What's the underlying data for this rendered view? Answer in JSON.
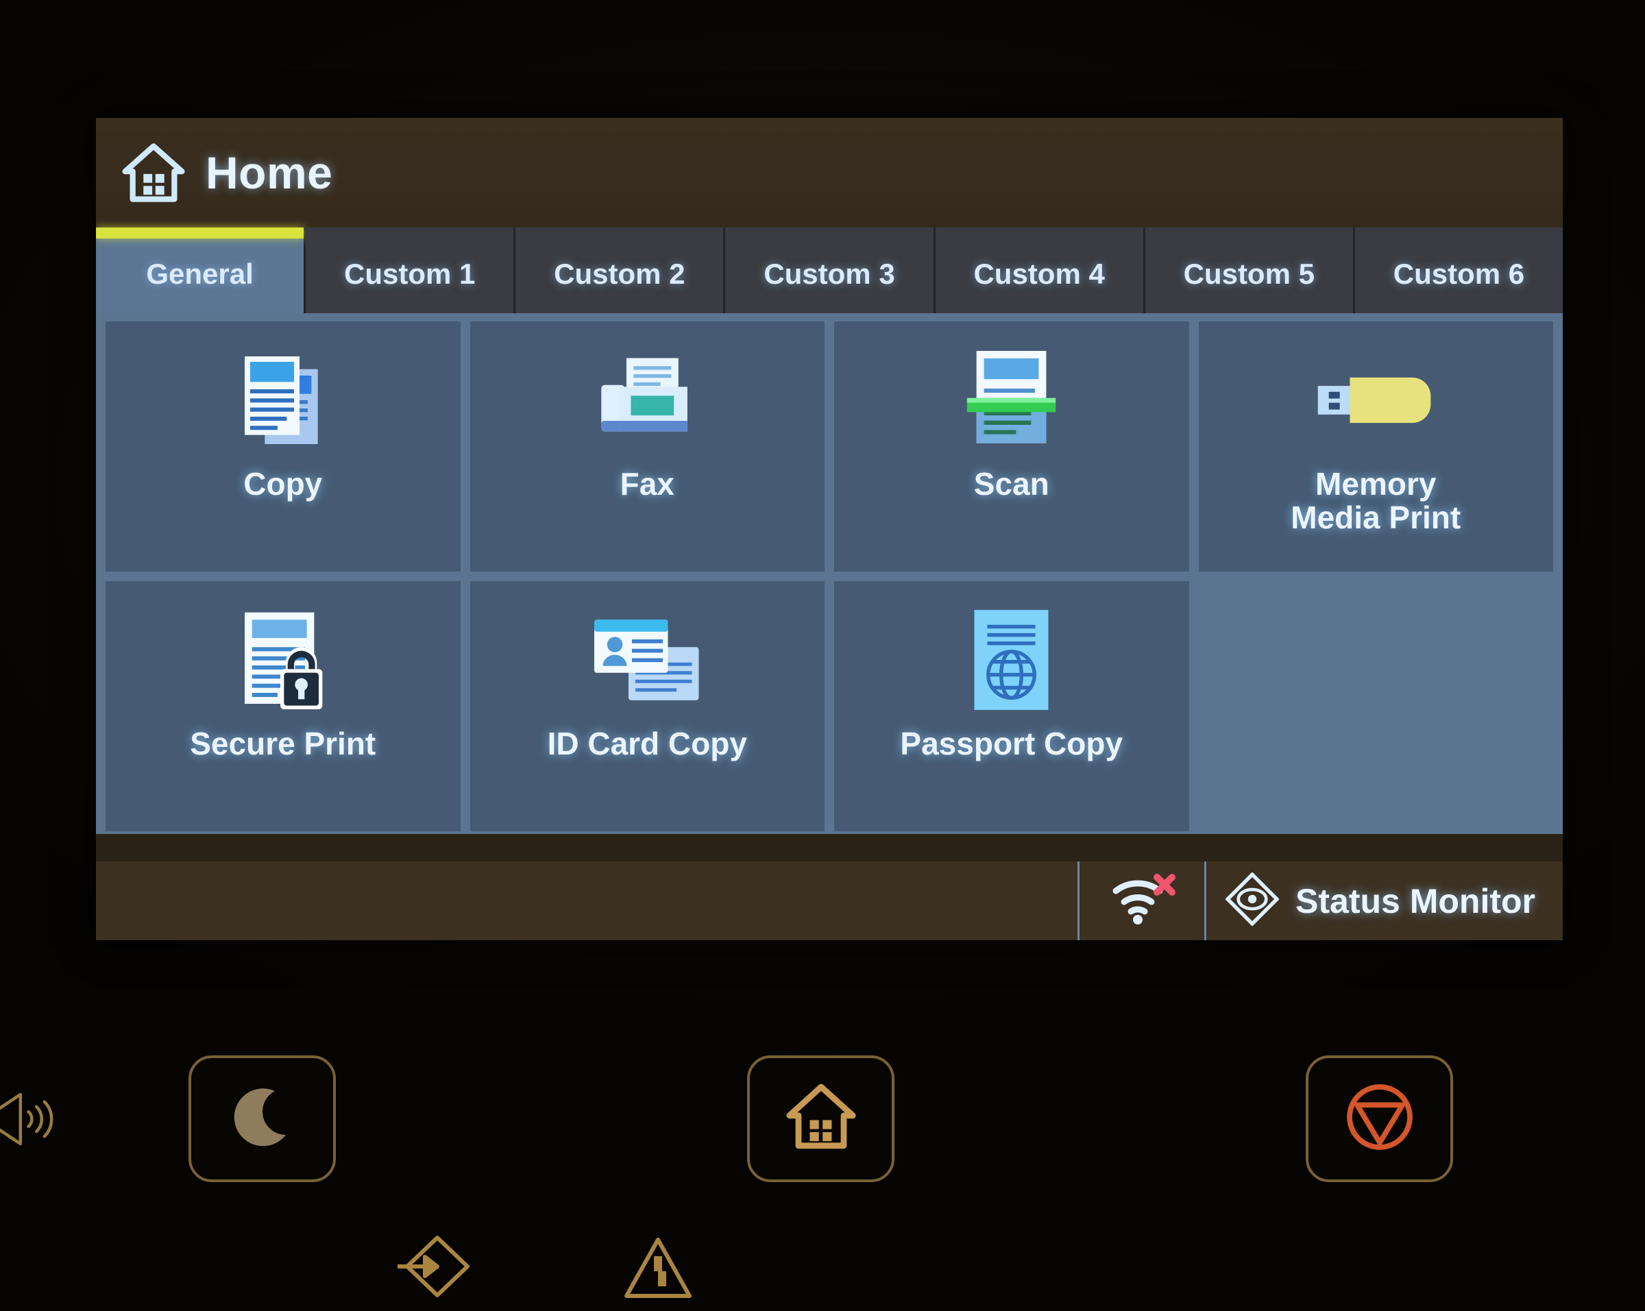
{
  "screen": {
    "header": {
      "title": "Home",
      "icon": "home-icon"
    },
    "tabs": [
      {
        "label": "General",
        "active": true,
        "name": "tab-general"
      },
      {
        "label": "Custom 1",
        "active": false,
        "name": "tab-custom-1"
      },
      {
        "label": "Custom 2",
        "active": false,
        "name": "tab-custom-2"
      },
      {
        "label": "Custom 3",
        "active": false,
        "name": "tab-custom-3"
      },
      {
        "label": "Custom 4",
        "active": false,
        "name": "tab-custom-4"
      },
      {
        "label": "Custom 5",
        "active": false,
        "name": "tab-custom-5"
      },
      {
        "label": "Custom 6",
        "active": false,
        "name": "tab-custom-6"
      }
    ],
    "tiles": [
      {
        "label": "Copy",
        "icon": "copy-documents-icon"
      },
      {
        "label": "Fax",
        "icon": "fax-machine-icon"
      },
      {
        "label": "Scan",
        "icon": "scan-document-icon"
      },
      {
        "label": "Memory\nMedia Print",
        "label_line1": "Memory",
        "label_line2": "Media Print",
        "icon": "usb-flash-drive-icon"
      },
      {
        "label": "Secure Print",
        "icon": "document-lock-icon"
      },
      {
        "label": "ID Card Copy",
        "icon": "id-cards-icon"
      },
      {
        "label": "Passport Copy",
        "icon": "passport-globe-icon"
      }
    ],
    "statusbar": {
      "wifi_icon": "wifi-disconnected-icon",
      "monitor_icon": "status-monitor-eye-icon",
      "monitor_label": "Status Monitor"
    }
  },
  "hardware": {
    "buttons": [
      {
        "name": "sleep-button",
        "icon": "crescent-moon-icon"
      },
      {
        "name": "home-button",
        "icon": "home-icon"
      },
      {
        "name": "stop-button",
        "icon": "stop-triangle-icon"
      }
    ],
    "indicators": [
      {
        "name": "volume-indicator",
        "icon": "speaker-icon"
      },
      {
        "name": "data-indicator",
        "icon": "arrow-into-diamond-icon"
      },
      {
        "name": "error-indicator",
        "icon": "warning-triangle-icon"
      }
    ]
  },
  "colors": {
    "active_tab_underline": "#d8e43c",
    "tab_active_bg": "#5c7694",
    "tab_bg": "#3a3c41",
    "grid_bg": "#5b7490",
    "tile_bg": "#465b73",
    "header_bg": "#3a2e1f",
    "statusbar_bg": "#3c3021",
    "text": "#eaf5ff",
    "wifi_error": "#f0556e",
    "stop_button": "#d4562a",
    "button_outline": "#7a6134"
  }
}
